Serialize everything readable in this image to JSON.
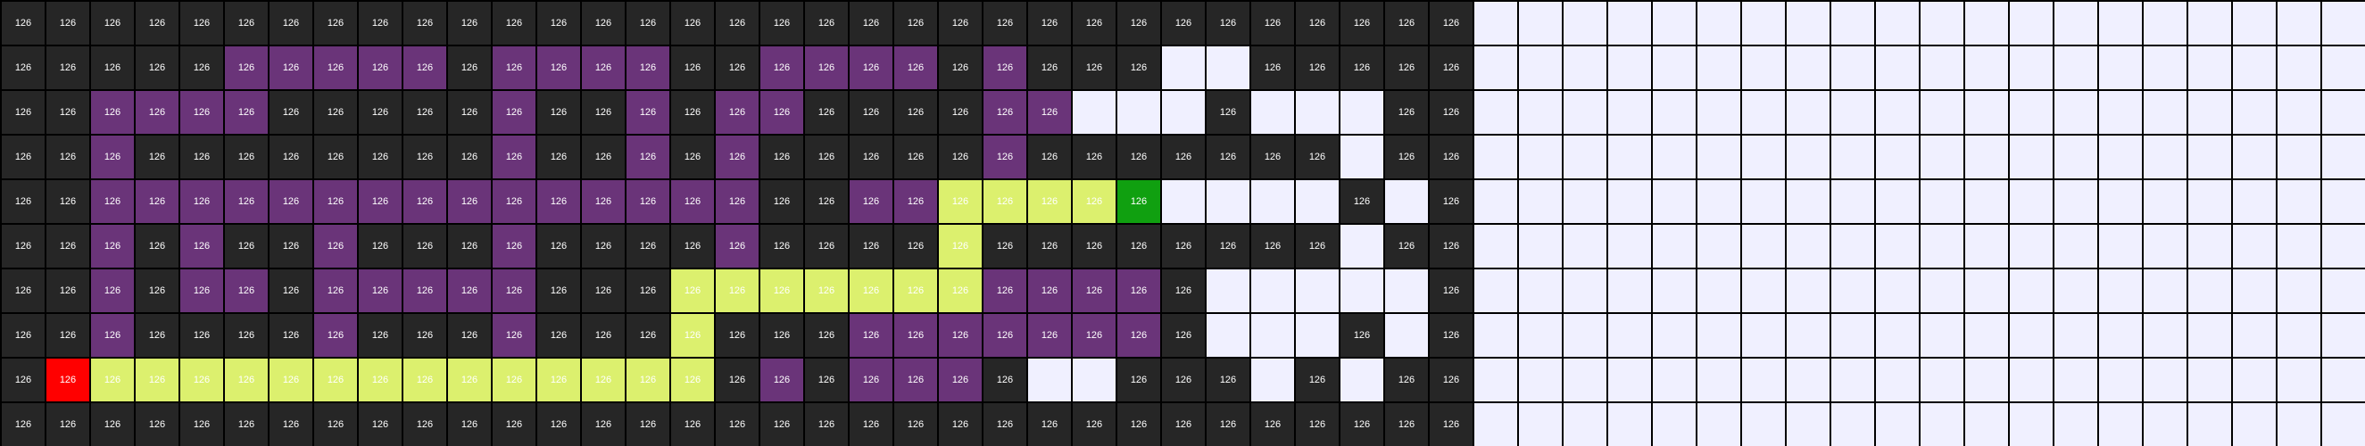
{
  "grid": {
    "cell_label": "126",
    "colors": {
      "W": "#f0f0ff",
      "B": "#262626",
      "P": "#6a3479",
      "Y": "#dcf06e",
      "R": "#ff0000",
      "G": "#10a010"
    },
    "text_colors": {
      "W": "#f0f0ff",
      "B": "#ffffff",
      "P": "#ffffff",
      "Y": "#ffffff",
      "R": "#ffffff",
      "G": "#ffffff"
    },
    "rows": [
      "BBBBBBBBBBBBBBBBBBBBBBBBBBBBBBBBBWWWWWWWWWWWWWWWWWWWW",
      "BBBBBPPPPPBPPPPBBPPPPBPBBBWWBBBBBWWWWWWWWWWWWWWWWWWWW",
      "BBPPPPBBBBBPBBPBPPBBBBPPWWWBWWWBBWWWWWWWWWWWWWWWWWWWW",
      "BBPBBBBBBBBPBBPBPBBBBBPBBBBBBBWBBWWWWWWWWWWWWWWWWWWWW",
      "BBPPPPPPPPPPPPPPPBBPPYYYYGWWWWBWBWWWWWWWWWWWWWWWWWWWW",
      "BBPBPBBPBBBPBBBBPBBBBYBBBBBBBBWBBWWWWWWWWWWWWWWWWWWWW",
      "BBPBPPBPPPPPBBBYYYYYYYPPPPBWWWWWBWWWWWWWWWWWWWWWWWWWW",
      "BBPBBBBPBBBPBBBYBBBPPPPPPPBWWWBWBWWWWWWWWWWWWWWWWWWWW",
      "BRYYYYYYYYYYYYYYBPBPPPBWWBBBWBWBBWWWWWWWWWWWWWWWWWWWW",
      "BBBBBBBBBBBBBBBBBBBBBBBBBBBBBBBBBWWWWWWWWWWWWWWWWWWWW"
    ]
  }
}
